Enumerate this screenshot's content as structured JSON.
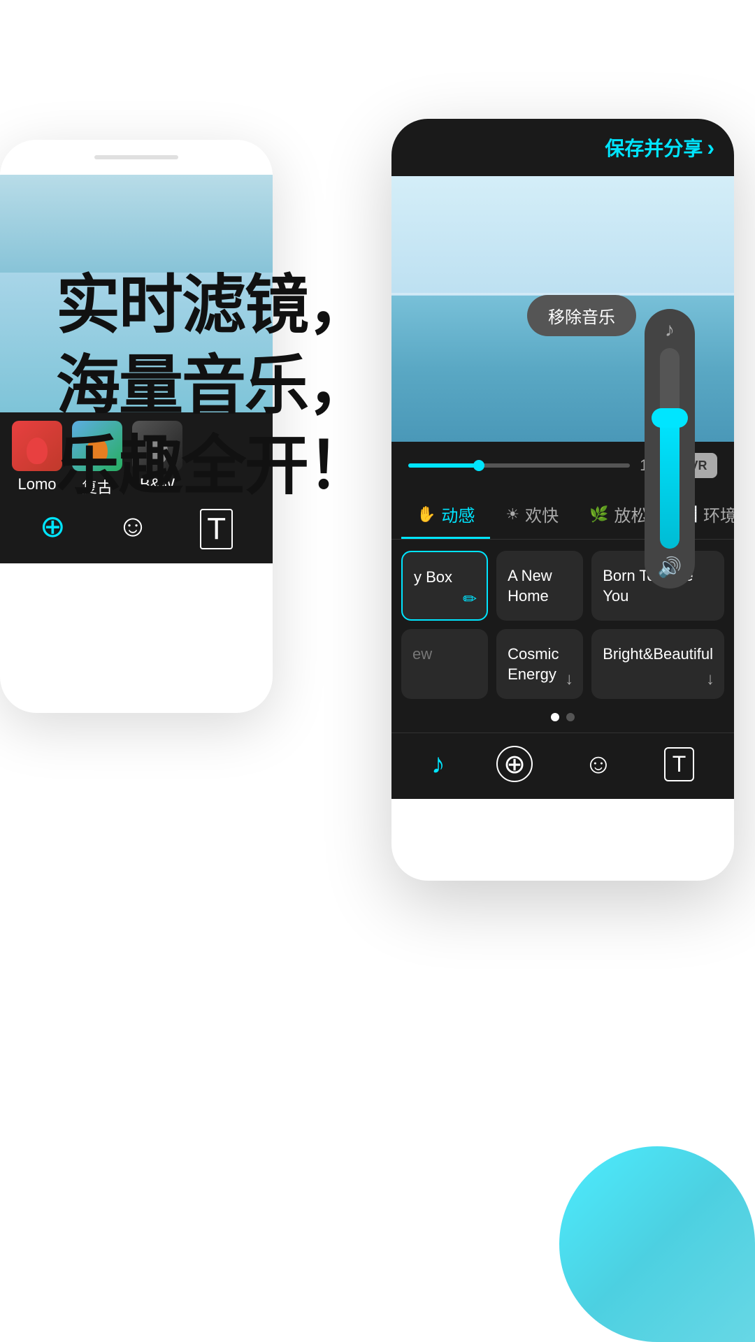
{
  "headline": {
    "line1": "实时滤镜，",
    "line2": "海量音乐，",
    "line3": "乐趣全开！"
  },
  "phone_bg": {
    "filters": [
      {
        "id": "lomo",
        "label": "Lomo"
      },
      {
        "id": "retro",
        "label": "复古"
      },
      {
        "id": "bw",
        "label": "B&W"
      }
    ],
    "icons": [
      "⊕",
      "☺",
      "T"
    ]
  },
  "phone_fg": {
    "header": {
      "save_share": "保存并分享",
      "arrow": "›"
    },
    "remove_music": "移除音乐",
    "progress": {
      "time": "1:23"
    },
    "music_tabs": [
      {
        "id": "dynamic",
        "label": "动感",
        "icon": "✋",
        "active": true
      },
      {
        "id": "happy",
        "label": "欢快",
        "icon": "☀"
      },
      {
        "id": "relaxed",
        "label": "放松",
        "icon": "🌿"
      },
      {
        "id": "ambient",
        "label": "环境音",
        "icon": "📊"
      }
    ],
    "music_cards_row1": [
      {
        "id": "mystery-box",
        "label": "y Box",
        "active": true,
        "has_edit": true
      },
      {
        "id": "new-home",
        "label": "A New Home",
        "active": false
      },
      {
        "id": "born-to-love",
        "label": "Born To Love You",
        "active": false
      }
    ],
    "music_cards_row2": [
      {
        "id": "new",
        "label": "ew",
        "active": false,
        "dim": true
      },
      {
        "id": "cosmic-energy",
        "label": "Cosmic Energy",
        "active": false,
        "has_download": true
      },
      {
        "id": "bright-beautiful",
        "label": "Bright&Beautiful",
        "active": false,
        "has_download": true
      }
    ],
    "toolbar_items": [
      {
        "id": "music",
        "icon": "♪",
        "active": true
      },
      {
        "id": "effects",
        "icon": "⊕",
        "active": false
      },
      {
        "id": "emoji",
        "icon": "☺",
        "active": false
      },
      {
        "id": "text",
        "icon": "T",
        "active": false
      }
    ]
  }
}
